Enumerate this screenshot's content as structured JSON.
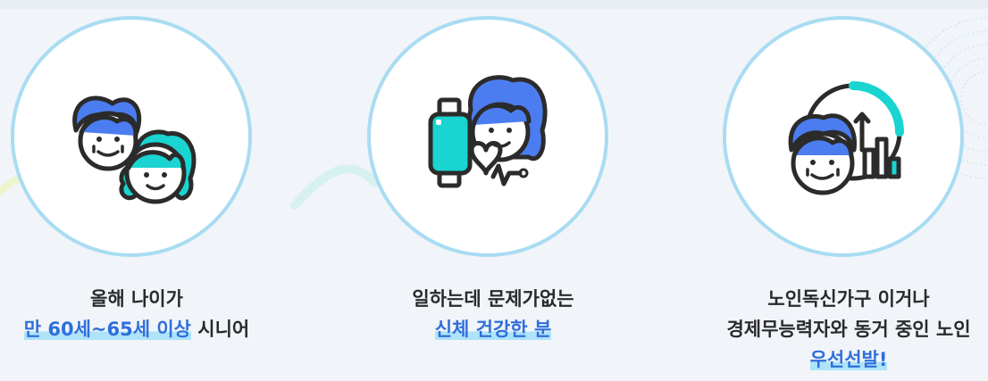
{
  "colors": {
    "accent_blue": "#2f6fdc",
    "highlight": "#aee3f9",
    "circle_border": "#a9dcf3",
    "icon_blue": "#4c7df0",
    "icon_teal": "#19d4d0"
  },
  "cards": [
    {
      "icon": "senior-couple-icon",
      "line1": "올해 나이가",
      "line2_highlight": "만 60세~65세 이상",
      "line2_rest": " 시니어"
    },
    {
      "icon": "smartwatch-health-icon",
      "line1": "일하는데 문제가없는",
      "line2_highlight": "신체 건강한 분"
    },
    {
      "icon": "senior-growth-chart-icon",
      "line1": "노인독신가구 이거나",
      "line2": "경제무능력자와 동거 중인 노인",
      "line3_highlight": "우선선발!"
    }
  ]
}
